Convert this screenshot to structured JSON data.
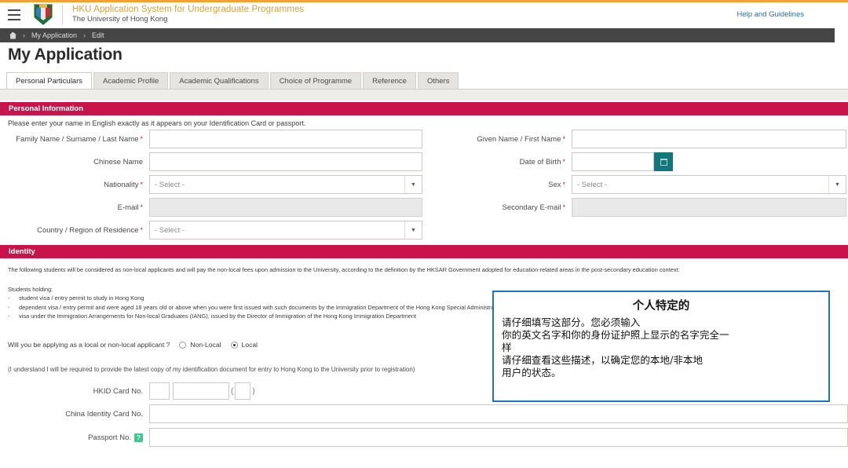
{
  "header": {
    "hamburger_icon": "menu-icon",
    "crest_icon": "hku-crest-icon",
    "title": "HKU Application System for Undergraduate Programmes",
    "subtitle": "The University of Hong Kong",
    "help_link": "Help and Guidelines"
  },
  "breadcrumb": {
    "home_icon": "home-icon",
    "separator": "›",
    "items": [
      "My Application",
      "Edit"
    ]
  },
  "page_title": "My Application",
  "tabs": [
    {
      "label": "Personal Particulars",
      "active": true
    },
    {
      "label": "Academic Profile",
      "active": false
    },
    {
      "label": "Academic Qualifications",
      "active": false
    },
    {
      "label": "Choice of Programme",
      "active": false
    },
    {
      "label": "Reference",
      "active": false
    },
    {
      "label": "Others",
      "active": false
    }
  ],
  "personal_information": {
    "section_title": "Personal Information",
    "hint": "Please enter your name in English exactly as it appears on your Identification Card or passport.",
    "fields": {
      "family_name": {
        "label": "Family Name / Surname / Last Name",
        "required": "*",
        "value": ""
      },
      "given_name": {
        "label": "Given Name / First Name",
        "required": "*",
        "value": ""
      },
      "chinese_name": {
        "label": "Chinese Name",
        "required": "",
        "value": ""
      },
      "date_of_birth": {
        "label": "Date of Birth",
        "required": "*",
        "value": "",
        "calendar_icon": "calendar-icon"
      },
      "nationality": {
        "label": "Nationality",
        "required": "*",
        "value": "- Select -"
      },
      "sex": {
        "label": "Sex",
        "required": "*",
        "value": "- Select -"
      },
      "email": {
        "label": "E-mail",
        "required": "*",
        "value": ""
      },
      "secondary_email": {
        "label": "Secondary E-mail",
        "required": "*",
        "value": ""
      },
      "country_region": {
        "label": "Country / Region of Residence",
        "required": "*",
        "value": "- Select -"
      }
    }
  },
  "identity": {
    "section_title": "Identity",
    "intro": "The following students will be considered as non-local applicants and will pay the non-local fees upon admission to the University, according to the definition by the HKSAR Government adopted for education-related areas in the post-secondary education context:",
    "students_holding_label": "Students holding:",
    "bullets": [
      "student visa / entry permit to study in Hong Kong",
      "dependent visa / entry permit and were aged 18 years old or above when you were first issued with such documents by the Immigration Department of the Hong Kong Special Administrative Region",
      "visa under the Immigration Arrangements for Non-local Graduates (IANG), issued by the Director of Immigration of the Hong Kong Immigration Department"
    ],
    "applicant_question": "Will you be applying as a local or non-local applicant ?",
    "options": [
      {
        "label": "Non-Local",
        "selected": false
      },
      {
        "label": "Local",
        "selected": true
      }
    ],
    "understanding_note": "(I understand I will be required to provide the latest copy of my identification document for entry to Hong Kong to the University prior to registration)",
    "hkid_label": "HKID Card No.",
    "hkid_open_paren": "(",
    "hkid_close_paren": ")",
    "china_id_label": "China Identity Card No.",
    "passport_label": "Passport No.",
    "passport_help_icon": "help-question-icon",
    "passport_help_glyph": "?"
  },
  "annotation": {
    "title": "个人特定的",
    "lines": [
      "请仔细填写这部分。您必须输入",
      "你的英文名字和你的身份证护照上显示的名字完全一",
      "样",
      "请仔细查看这些描述，以确定您的本地/非本地",
      "用户的状态。"
    ],
    "border_color": "#1f72c4"
  },
  "colors": {
    "accent_orange": "#f0a330",
    "section_crimson": "#c8134b",
    "breadcrumb_dark": "#454545",
    "calendar_teal": "#13767a",
    "help_green": "#3ec98f",
    "link_blue": "#2d6ca2",
    "title_gold": "#d9a23a"
  }
}
